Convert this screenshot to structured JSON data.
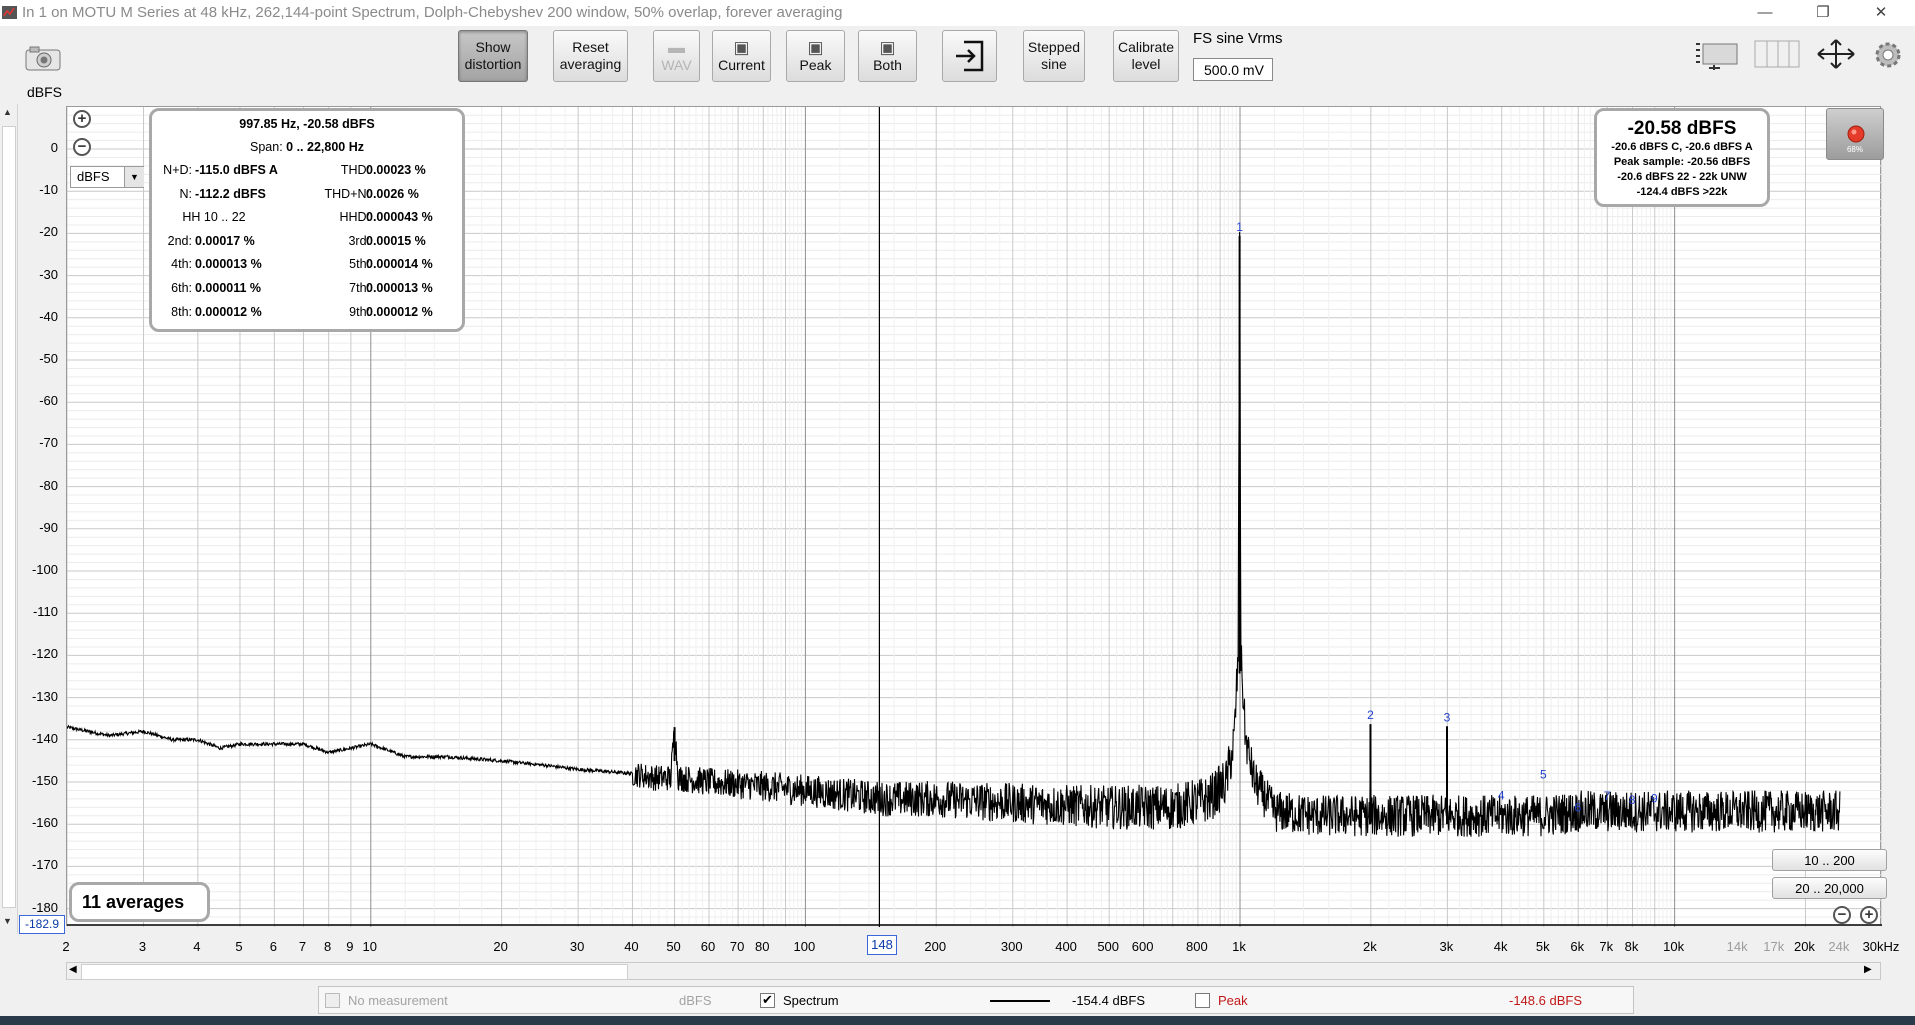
{
  "window": {
    "title": "In 1 on MOTU M Series at 48 kHz, 262,144-point Spectrum, Dolph-Chebyshev 200 window, 50% overlap, forever averaging",
    "minimize_glyph": "—",
    "restore_glyph": "❐",
    "close_glyph": "✕"
  },
  "toolbar": {
    "snapshot_icon": "camera-icon",
    "show_distortion": [
      "Show",
      "distortion"
    ],
    "reset_averaging": [
      "Reset",
      "averaging"
    ],
    "wav_label": "WAV",
    "current_label": "Current",
    "peak_label": "Peak",
    "both_label": "Both",
    "stepped_sine": [
      "Stepped",
      "sine"
    ],
    "calibrate_level": [
      "Calibrate",
      "level"
    ],
    "fs_sine_label": "FS sine Vrms",
    "fs_sine_value": "500.0 mV"
  },
  "axis": {
    "unit_label": "dBFS",
    "unit_select": "dBFS",
    "y_ticks": [
      "0",
      "-10",
      "-20",
      "-30",
      "-40",
      "-50",
      "-60",
      "-70",
      "-80",
      "-90",
      "-100",
      "-110",
      "-120",
      "-130",
      "-140",
      "-150",
      "-160",
      "-170",
      "-180"
    ],
    "x_ticks": [
      "2",
      "3",
      "4",
      "5",
      "6",
      "7",
      "8",
      "9",
      "10",
      "20",
      "30",
      "40",
      "50",
      "60",
      "70",
      "80",
      "100",
      "200",
      "300",
      "400",
      "500",
      "600",
      "800",
      "1k",
      "2k",
      "3k",
      "4k",
      "5k",
      "6k",
      "7k",
      "8k",
      "10k",
      "14k",
      "17k",
      "20k",
      "24k",
      "30kHz"
    ],
    "x_ticks_grey": [
      "14k",
      "17k",
      "24k"
    ],
    "cursor_x": "148",
    "cursor_y": "-182.9"
  },
  "distortion": {
    "header": "997.85 Hz, -20.58 dBFS",
    "span_label": "Span:",
    "span_value": "0 .. 22,800 Hz",
    "rows": [
      {
        "l1": "N+D:",
        "v1": "-115.0 dBFS A",
        "l2": "THD:",
        "v2": "0.00023 %"
      },
      {
        "l1": "N:",
        "v1": "-112.2 dBFS",
        "l2": "THD+N:",
        "v2": "0.0026 %"
      },
      {
        "l1": "HH 10 .. 22",
        "v1": "",
        "l2": "HHD:",
        "v2": "0.000043 %"
      },
      {
        "l1": "2nd:",
        "v1": "0.00017 %",
        "l2": "3rd:",
        "v2": "0.00015 %"
      },
      {
        "l1": "4th:",
        "v1": "0.000013 %",
        "l2": "5th:",
        "v2": "0.000014 %"
      },
      {
        "l1": "6th:",
        "v1": "0.000011 %",
        "l2": "7th:",
        "v2": "0.000013 %"
      },
      {
        "l1": "8th:",
        "v1": "0.000012 %",
        "l2": "9th:",
        "v2": "0.000012 %"
      }
    ]
  },
  "level": {
    "main": "-20.58 dBFS",
    "lines": [
      "-20.6 dBFS C, -20.6 dBFS A",
      "Peak sample: -20.56 dBFS",
      "-20.6 dBFS 22 - 22k UNW",
      "-124.4 dBFS >22k"
    ]
  },
  "record_level": "68%",
  "averages": "11 averages",
  "range_buttons": [
    "10 .. 200",
    "20 .. 20,000"
  ],
  "legend": {
    "no_measurement": "No measurement",
    "no_measurement_unit": "dBFS",
    "spectrum_label": "Spectrum",
    "spectrum_checked": true,
    "spectrum_value": "-154.4 dBFS",
    "peak_label": "Peak",
    "peak_checked": false,
    "peak_value": "-148.6 dBFS",
    "peak_color": "#c01818"
  },
  "chart_data": {
    "type": "line",
    "xscale": "log",
    "xlim": [
      2,
      30000
    ],
    "ylim": [
      -180,
      10
    ],
    "ylabel": "dBFS",
    "series": [
      {
        "name": "Spectrum",
        "color": "#000000",
        "points": [
          [
            2,
            -137
          ],
          [
            2.5,
            -139
          ],
          [
            3,
            -138
          ],
          [
            3.5,
            -140
          ],
          [
            4,
            -140
          ],
          [
            4.5,
            -142
          ],
          [
            5,
            -141
          ],
          [
            6,
            -141
          ],
          [
            7,
            -141
          ],
          [
            8,
            -143
          ],
          [
            9,
            -142
          ],
          [
            10,
            -141
          ],
          [
            12,
            -144
          ],
          [
            15,
            -144
          ],
          [
            20,
            -145
          ],
          [
            25,
            -146
          ],
          [
            30,
            -147
          ],
          [
            40,
            -148
          ],
          [
            45,
            -149
          ],
          [
            49,
            -149
          ],
          [
            50,
            -137
          ],
          [
            51,
            -149
          ],
          [
            60,
            -150
          ],
          [
            80,
            -151
          ],
          [
            100,
            -152
          ],
          [
            150,
            -154
          ],
          [
            200,
            -154
          ],
          [
            300,
            -155
          ],
          [
            500,
            -156
          ],
          [
            700,
            -156
          ],
          [
            850,
            -154
          ],
          [
            930,
            -150
          ],
          [
            970,
            -140
          ],
          [
            990,
            -120
          ],
          [
            997.85,
            -20.58
          ],
          [
            1005,
            -120
          ],
          [
            1030,
            -140
          ],
          [
            1080,
            -150
          ],
          [
            1200,
            -157
          ],
          [
            1500,
            -158
          ],
          [
            1990,
            -158
          ],
          [
            1996,
            -136.3
          ],
          [
            2002,
            -158
          ],
          [
            2990,
            -158
          ],
          [
            2994,
            -136.8
          ],
          [
            3000,
            -158
          ],
          [
            4000,
            -158
          ],
          [
            5000,
            -158
          ],
          [
            6000,
            -157
          ],
          [
            8000,
            -157
          ],
          [
            10000,
            -157
          ],
          [
            15000,
            -157
          ],
          [
            20000,
            -157
          ],
          [
            24000,
            -157
          ]
        ]
      }
    ],
    "harmonic_markers": [
      {
        "n": "1",
        "freq": 997.85,
        "level": -20.58
      },
      {
        "n": "2",
        "freq": 1996,
        "level": -136.3
      },
      {
        "n": "3",
        "freq": 2994,
        "level": -136.8
      },
      {
        "n": "4",
        "freq": 3991,
        "level": -155.3
      },
      {
        "n": "5",
        "freq": 4989,
        "level": -150.4
      },
      {
        "n": "6",
        "freq": 5987,
        "level": -158.2
      },
      {
        "n": "7",
        "freq": 6985,
        "level": -155.4
      },
      {
        "n": "8",
        "freq": 7983,
        "level": -156.4
      },
      {
        "n": "9",
        "freq": 8981,
        "level": -156.0
      }
    ],
    "cursor_freq": 148
  }
}
